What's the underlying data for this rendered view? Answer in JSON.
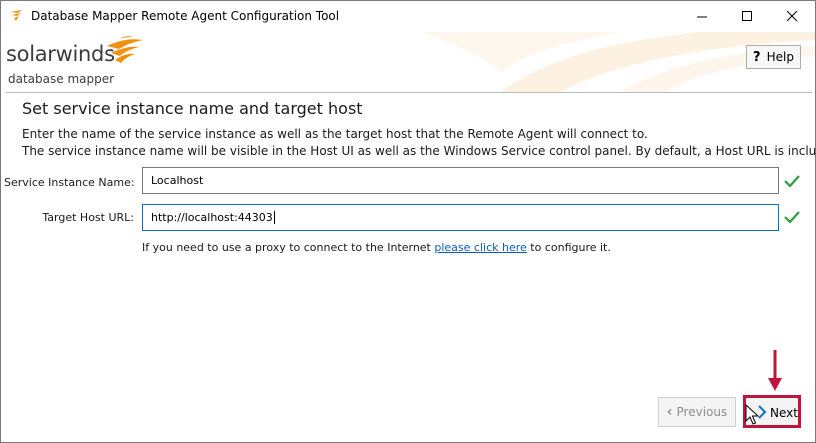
{
  "window": {
    "title": "Database Mapper Remote Agent Configuration Tool",
    "icon": "solarwinds-flame-icon",
    "controls": [
      "minimize",
      "maximize",
      "close"
    ]
  },
  "banner": {
    "brand": "solarwinds",
    "product": "database mapper",
    "help_label": "Help",
    "help_icon": "question-mark-icon"
  },
  "page": {
    "title": "Set service instance name and target host",
    "description_line1": "Enter the name of the service instance as well as the target host that the Remote Agent will connect to.",
    "description_line2": "The service instance name will be visible in the Host UI as well as the Windows Service control panel. By default, a Host URL is included."
  },
  "form": {
    "service_instance": {
      "label": "Service Instance Name:",
      "value": "Localhost",
      "valid": true
    },
    "target_host": {
      "label": "Target Host URL:",
      "value": "http://localhost:44303",
      "valid": true
    },
    "proxy": {
      "text_before": "If you need to use a proxy to connect to the Internet ",
      "link_text": "please click here",
      "text_after": " to configure it."
    }
  },
  "footer": {
    "previous_label": "Previous",
    "previous_enabled": false,
    "next_label": "Next"
  },
  "colors": {
    "accent_orange": "#f29111",
    "annotation_red": "#c0143c",
    "valid_green": "#2e9e3a",
    "link_blue": "#0b5cc1"
  }
}
